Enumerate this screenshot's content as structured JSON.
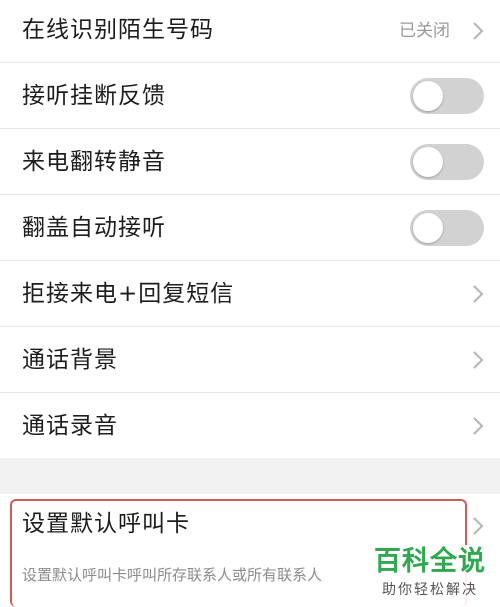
{
  "settings": {
    "rows": [
      {
        "label": "在线识别陌生号码",
        "status": "已关闭"
      },
      {
        "label": "接听挂断反馈",
        "toggle": false
      },
      {
        "label": "来电翻转静音",
        "toggle": false
      },
      {
        "label": "翻盖自动接听",
        "toggle": false
      },
      {
        "label": "拒接来电+回复短信"
      },
      {
        "label": "通话背景"
      },
      {
        "label": "通话录音"
      }
    ],
    "default_card": {
      "label": "设置默认呼叫卡",
      "description": "设置默认呼叫卡呼叫所存联系人或所有联系人"
    }
  },
  "watermark": {
    "title": "百科全说",
    "subtitle": "助你轻松解决"
  },
  "colors": {
    "toggle_off": "#d2d2d2",
    "highlight_border": "#d65a5a",
    "watermark_green": "#2fa84f"
  }
}
